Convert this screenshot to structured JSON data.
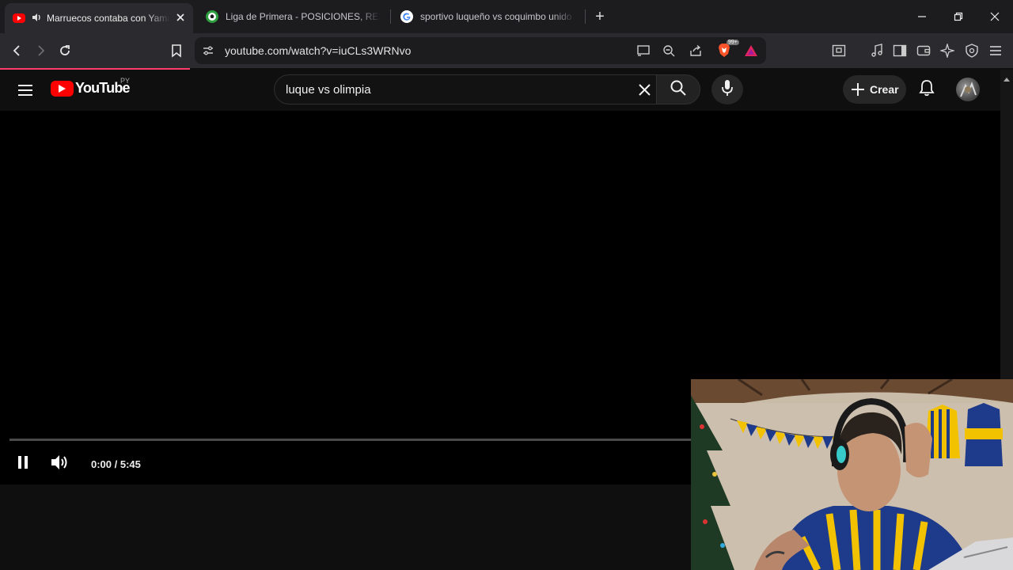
{
  "browser": {
    "tabs": [
      {
        "title": "Marruecos contaba con Yamal",
        "active": true,
        "audio": true
      },
      {
        "title": "Liga de Primera - POSICIONES, RESULTADOS",
        "active": false
      },
      {
        "title": "sportivo luqueño vs coquimbo unido",
        "active": false
      }
    ],
    "new_tab_symbol": "+",
    "url": "youtube.com/watch?v=iuCLs3WRNvo",
    "brave_shield_count": "99+"
  },
  "youtube": {
    "logo_text": "YouTube",
    "country_code": "PY",
    "search_query": "luque vs olimpia",
    "create_label": "Crear"
  },
  "player": {
    "time_display": "0:00 / 5:45",
    "state": "playing"
  },
  "colors": {
    "youtube_red": "#ff0000",
    "brave_orange": "#fb542b",
    "loading_bar": "#ff3d6b"
  }
}
